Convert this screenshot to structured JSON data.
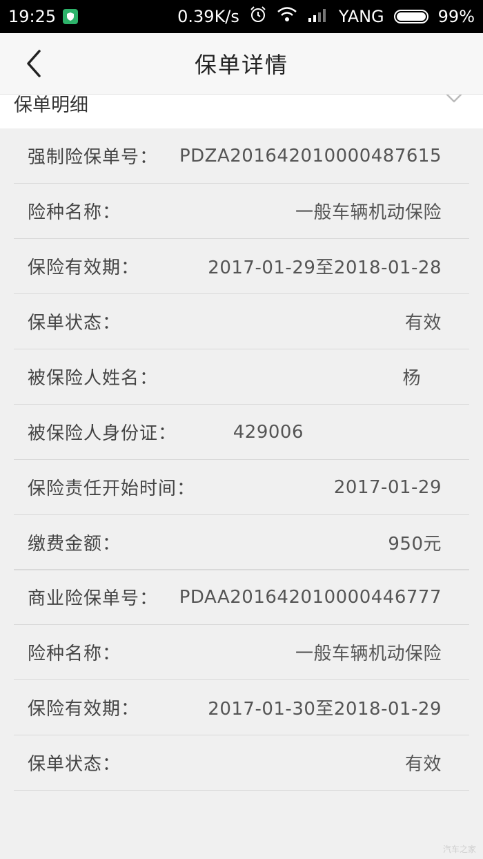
{
  "status_bar": {
    "time": "19:25",
    "net_speed": "0.39K/s",
    "carrier": "YANG",
    "battery": "99%"
  },
  "header": {
    "title": "保单详情"
  },
  "section": {
    "title": "保单明细"
  },
  "compulsory": {
    "rows": [
      {
        "label": "强制险保单号：",
        "value": "PDZA20164201000048761​5"
      },
      {
        "label": "险种名称：",
        "value": "一般车辆机动保险"
      },
      {
        "label": "保险有效期：",
        "value": "2017-01-29至2018-01-28"
      },
      {
        "label": "保单状态：",
        "value": "有效"
      },
      {
        "label": "被保险人姓名：",
        "value": "杨"
      },
      {
        "label": "被保险人身份证：",
        "value": "429006"
      },
      {
        "label": "保险责任开始时间：",
        "value": "2017-01-29"
      },
      {
        "label": "缴费金额：",
        "value": "950元"
      }
    ]
  },
  "commercial": {
    "rows": [
      {
        "label": "商业险保单号：",
        "value": "PDAA20164201000044677​7"
      },
      {
        "label": "险种名称：",
        "value": "一般车辆机动保险"
      },
      {
        "label": "保险有效期：",
        "value": "2017-01-30至2018-01-29"
      },
      {
        "label": "保单状态：",
        "value": "有效"
      }
    ]
  },
  "watermark": "汽车之家"
}
